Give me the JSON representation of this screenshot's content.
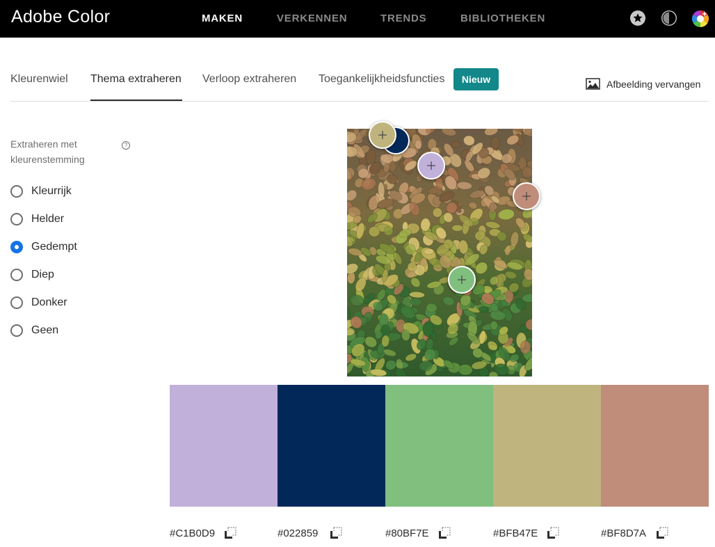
{
  "app": {
    "title": "Adobe Color"
  },
  "nav": {
    "items": [
      {
        "label": "MAKEN",
        "active": true
      },
      {
        "label": "VERKENNEN",
        "active": false
      },
      {
        "label": "TRENDS",
        "active": false
      },
      {
        "label": "BIBLIOTHEKEN",
        "active": false
      }
    ],
    "icons": [
      "star-icon",
      "contrast-icon",
      "color-wheel-icon"
    ]
  },
  "tabs": {
    "items": [
      {
        "label": "Kleurenwiel",
        "active": false
      },
      {
        "label": "Thema extraheren",
        "active": true
      },
      {
        "label": "Verloop extraheren",
        "active": false
      },
      {
        "label": "Toegankelijkheidsfuncties",
        "active": false
      }
    ],
    "badge": "Nieuw",
    "replace_image": "Afbeelding vervangen"
  },
  "mood": {
    "label": "Extraheren met kleurenstemming",
    "options": [
      {
        "label": "Kleurrijk",
        "checked": false
      },
      {
        "label": "Helder",
        "checked": false
      },
      {
        "label": "Gedempt",
        "checked": true
      },
      {
        "label": "Diep",
        "checked": false
      },
      {
        "label": "Donker",
        "checked": false
      },
      {
        "label": "Geen",
        "checked": false
      }
    ]
  },
  "swatches": [
    {
      "hex": "#C1B0D9",
      "color": "#C1B0D9"
    },
    {
      "hex": "#022859",
      "color": "#022859"
    },
    {
      "hex": "#80BF7E",
      "color": "#80BF7E"
    },
    {
      "hex": "#BFB47E",
      "color": "#BFB47E"
    },
    {
      "hex": "#BF8D7A",
      "color": "#BF8D7A"
    }
  ],
  "colors": {
    "accent": "#1473e6",
    "badge": "#12888a",
    "topbar": "#000000"
  }
}
